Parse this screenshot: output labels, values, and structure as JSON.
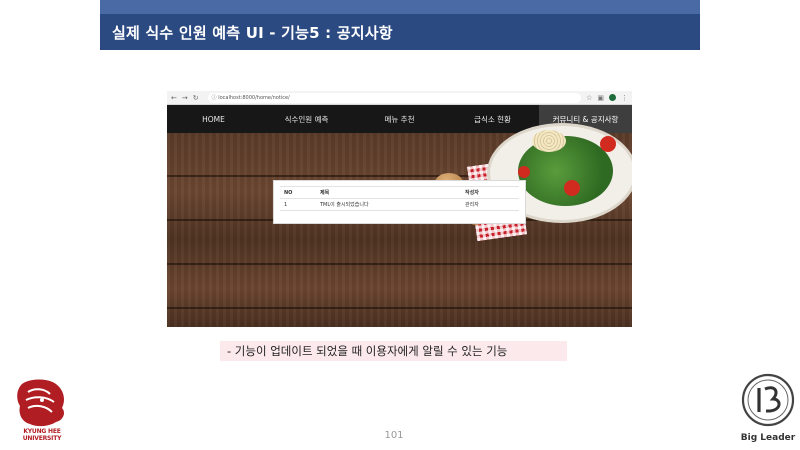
{
  "slide": {
    "title": "실제 식수 인원 예측 UI - 기능5 : 공지사항",
    "caption": "- 기능이 업데이트 되었을 때 이용자에게 알릴 수 있는 기능",
    "page_number": "101"
  },
  "browser": {
    "url": "localhost:8000/home/notice/",
    "nav_icons": [
      "back-icon",
      "forward-icon",
      "reload-icon"
    ]
  },
  "site_nav": {
    "items": [
      {
        "label": "HOME"
      },
      {
        "label": "식수인원 예측"
      },
      {
        "label": "메뉴 추천"
      },
      {
        "label": "급식소 현황"
      },
      {
        "label": "커뮤니티 & 공지사항"
      }
    ],
    "active_index": 4
  },
  "notice_table": {
    "headers": {
      "no": "NO",
      "title": "제목",
      "writer": "작성자"
    },
    "rows": [
      {
        "no": "1",
        "title": "TML이 출시되었습니다",
        "writer": "관리자"
      }
    ]
  },
  "logos": {
    "university": "KYUNG HEE UNIVERSITY",
    "brand": "Big Leader"
  },
  "colors": {
    "header_band": "#2b4a82",
    "caption_bg": "#fbe9ec",
    "nav_bg": "#171717",
    "university_red": "#b01e23"
  }
}
